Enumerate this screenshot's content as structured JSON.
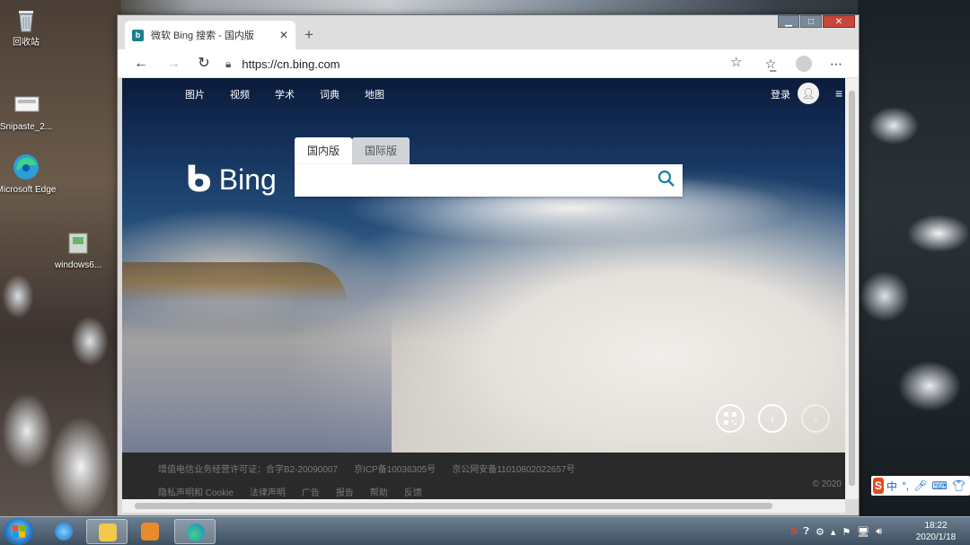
{
  "desktop": {
    "icons": [
      {
        "label": "回收站"
      },
      {
        "label": "Snipaste_2..."
      },
      {
        "label": "Microsoft Edge"
      },
      {
        "label": "windows6..."
      }
    ]
  },
  "browser": {
    "tab_title": "微软 Bing 搜索 - 国内版",
    "url": "https://cn.bing.com",
    "window_controls": {
      "minimize": "▁",
      "maximize": "□",
      "close": "✕"
    }
  },
  "bing": {
    "nav": [
      "图片",
      "视频",
      "学术",
      "词典",
      "地图"
    ],
    "login": "登录",
    "logo_text": "Bing",
    "search_tabs": {
      "domestic": "国内版",
      "international": "国际版"
    },
    "footer": {
      "row1": [
        "增值电信业务经营许可证：合字B2-20090007",
        "京ICP备10036305号",
        "京公网安备11010802022657号"
      ],
      "row2": [
        "隐私声明和 Cookie",
        "法律声明",
        "广告",
        "报告",
        "帮助",
        "反馈"
      ],
      "copyright": "© 2020"
    }
  },
  "ime": {
    "mode": "中"
  },
  "taskbar": {
    "time": "18:22",
    "date": "2020/1/18"
  },
  "colors": {
    "bing_accent": "#1b7fa3",
    "ime_brand": "#e54a1d"
  }
}
